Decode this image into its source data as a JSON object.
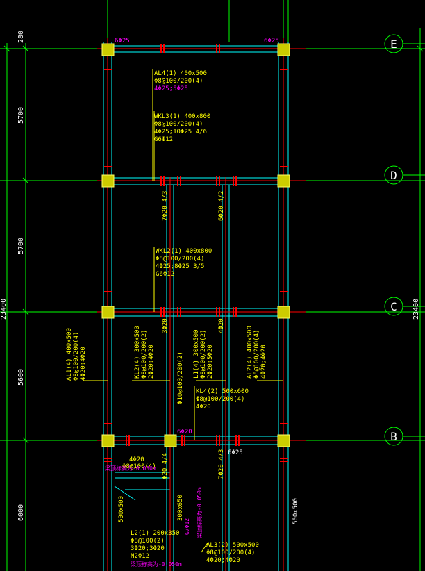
{
  "dims_left": [
    "280",
    "5700",
    "5700",
    "5600",
    "6000"
  ],
  "dim_total_left": "23400",
  "dim_total_right": "23400",
  "axes": [
    "E",
    "D",
    "C",
    "B"
  ],
  "top_rebar": [
    "6Φ25",
    "6Φ25"
  ],
  "beams": {
    "al4": [
      "AL4(1) 400x500",
      "Φ8@100/200(4)",
      "4Φ25;5Φ25"
    ],
    "wkl3": [
      "WKL3(1) 400x800",
      "Φ8@100/200(4)",
      "4Φ25;10Φ25 4/6",
      "G6Φ12"
    ],
    "wkl2": [
      "WKL2(1) 400x800",
      "Φ8@100/200(4)",
      "4Φ25;8Φ25 3/5",
      "G6Φ12"
    ],
    "al1": [
      "AL1(4) 400x500",
      "Φ8@100/200(4)",
      "4Φ20;4Φ20"
    ],
    "kl2": [
      "KL2(4) 300x500",
      "Φ8@100/200(2)",
      "2Φ20;4Φ20"
    ],
    "l1": [
      "L1(4) 300x500",
      "Φ8@100/200(2)",
      "2Φ20;5Φ20"
    ],
    "al2": [
      "AL2(4) 400x500",
      "Φ8@100/200(4)",
      "4Φ20;4Φ20"
    ],
    "kl4": [
      "KL4(2) 500x600",
      "Φ8@100/200(4)",
      "4Φ20"
    ],
    "l2": [
      "L2(1) 200x350",
      "Φ8@100(2)",
      "3Φ20;3Φ20",
      "N2Φ12"
    ],
    "al3": [
      "AL3(2) 500x500",
      "Φ8@100/200(4)",
      "4Φ20;4Φ20"
    ]
  },
  "vertical_notes": {
    "v1": "7Φ20 4/3",
    "v2": "6Φ20 4/2",
    "v3": "3Φ20",
    "v4": "4Φ20",
    "v5": "Φ10@100/200(2)",
    "v6": "Φ20 4/4",
    "v7": "7Φ20 4/3",
    "v8": "300x650",
    "v9": "500x500",
    "v10": "500x500"
  },
  "small_notes": {
    "n6020": "6Φ20",
    "n6025": "6Φ25",
    "n420": "4Φ20",
    "n8100": "Φ8@100(4)",
    "elev1": "梁顶标高为-0.050m",
    "elev2": "梁顶标高为-0.050m",
    "pink1": "梁顶标高为-0.050m",
    "pink2": "G7Φ12"
  }
}
